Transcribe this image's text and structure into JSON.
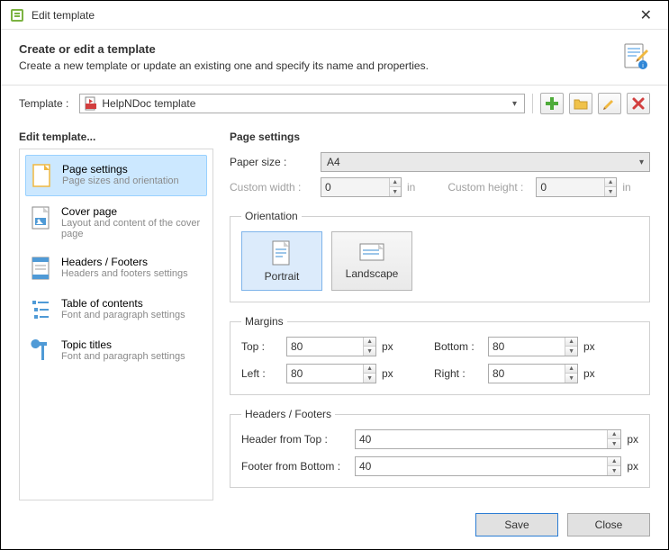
{
  "title": "Edit template",
  "header": {
    "title": "Create or edit a template",
    "sub": "Create a new template or update an existing one and specify its name and properties."
  },
  "toolbar": {
    "template_label": "Template :",
    "template_value": "HelpNDoc template"
  },
  "sidebar": {
    "title": "Edit template...",
    "items": [
      {
        "title": "Page settings",
        "sub": "Page sizes and orientation"
      },
      {
        "title": "Cover page",
        "sub": "Layout and content of the cover page"
      },
      {
        "title": "Headers / Footers",
        "sub": "Headers and footers settings"
      },
      {
        "title": "Table of contents",
        "sub": "Font and paragraph settings"
      },
      {
        "title": "Topic titles",
        "sub": "Font and paragraph settings"
      }
    ]
  },
  "main": {
    "title": "Page settings",
    "paper_label": "Paper size :",
    "paper_value": "A4",
    "cw_label": "Custom width :",
    "cw_value": "0",
    "cw_unit": "in",
    "ch_label": "Custom height :",
    "ch_value": "0",
    "ch_unit": "in",
    "orientation": {
      "legend": "Orientation",
      "portrait": "Portrait",
      "landscape": "Landscape"
    },
    "margins": {
      "legend": "Margins",
      "top_label": "Top :",
      "top_value": "80",
      "bottom_label": "Bottom :",
      "bottom_value": "80",
      "left_label": "Left :",
      "left_value": "80",
      "right_label": "Right :",
      "right_value": "80",
      "unit": "px"
    },
    "hf": {
      "legend": "Headers / Footers",
      "hft_label": "Header from Top :",
      "hft_value": "40",
      "ffb_label": "Footer from Bottom :",
      "ffb_value": "40",
      "unit": "px"
    }
  },
  "footer": {
    "save": "Save",
    "close": "Close"
  }
}
